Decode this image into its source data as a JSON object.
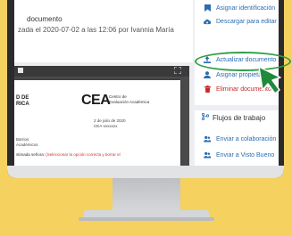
{
  "document": {
    "title": "documento",
    "meta": "zada el 2020-07-02 a las 12:06 por Ivannia María"
  },
  "viewer": {
    "expand_icon": "expand-icon",
    "page": {
      "left_header": "D DE\nRICA",
      "logo_text": "CEA",
      "logo_fulltext": "Centro de\nEvaluación Académica",
      "date": "2 de julio de 2020\nCEA-xxxxxxx",
      "recipient": "Barrios\nAcadémicos",
      "salutation_prefix": "stimada señora:",
      "salutation_note": "(Seleccionar la opción correcta y borrar el"
    }
  },
  "actions": [
    {
      "label": "Asignar identificación",
      "icon": "bookmark-icon",
      "danger": false
    },
    {
      "label": "Descargar para editar",
      "icon": "cloud-download-icon",
      "danger": false
    },
    {
      "label": "Actualizar documento",
      "icon": "upload-icon",
      "danger": false
    },
    {
      "label": "Asignar propietario",
      "icon": "user-icon",
      "danger": false
    },
    {
      "label": "Eliminar documento",
      "icon": "trash-icon",
      "danger": true
    }
  ],
  "workflows": {
    "title": "Flujos de trabajo",
    "items": [
      {
        "label": "Enviar a colaboración",
        "icon": "users-icon"
      },
      {
        "label": "Enviar a Visto Bueno",
        "icon": "users-icon"
      }
    ]
  },
  "colors": {
    "background": "#f5d160",
    "link": "#2b6cb0",
    "danger": "#c62828",
    "highlight": "#2e9e45"
  }
}
